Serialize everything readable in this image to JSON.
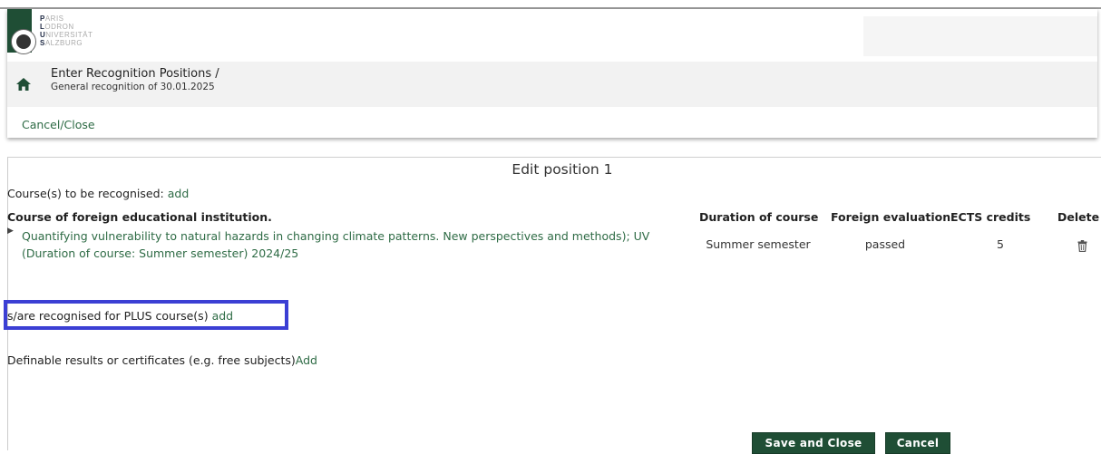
{
  "logo": {
    "line1": "ARIS",
    "line1_initial": "P",
    "line2": "ODRON",
    "line2_initial": "L",
    "line3": "NIVERSITÄT",
    "line3_initial": "U",
    "line4": "ALZBURG",
    "line4_initial": "S"
  },
  "breadcrumb": {
    "title": "Enter Recognition Positions  /",
    "subtitle": "General recognition of 30.01.2025"
  },
  "actions": {
    "cancel_close": "Cancel/Close"
  },
  "edit": {
    "title": "Edit position 1",
    "courses_label": "Course(s) to be recognised: ",
    "courses_add": "add",
    "table": {
      "headers": {
        "course": "Course of foreign educational institution.",
        "duration": "Duration of course",
        "evaluation": "Foreign evaluation",
        "ects": "ECTS credits",
        "delete": "Delete"
      },
      "rows": [
        {
          "course": "Quantifying vulnerability to natural hazards in changing climate patterns. New perspectives and methods); UV (Duration of course: Summer semester) 2024/25",
          "duration": "Summer semester",
          "evaluation": "passed",
          "ects": "5"
        }
      ]
    },
    "plus_label": "s/are recognised for PLUS course(s) ",
    "plus_add": "add",
    "definable_label": "Definable results or certificates (e.g. free subjects)",
    "definable_add": "Add"
  },
  "buttons": {
    "save_close": "Save and Close",
    "cancel": "Cancel"
  },
  "colors": {
    "brand": "#1f4e35",
    "link": "#2e6b45",
    "highlight": "#3b3fd4"
  }
}
